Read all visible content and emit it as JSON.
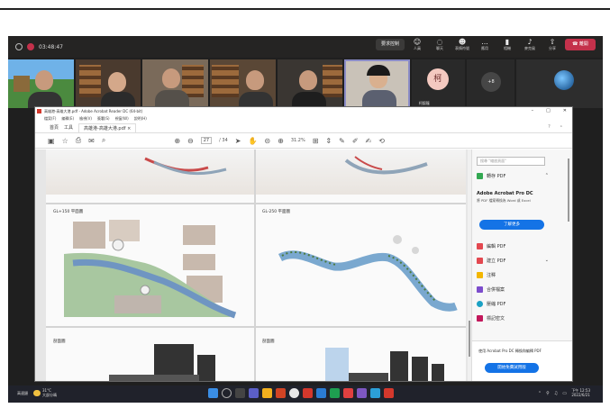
{
  "meeting": {
    "timer": "03:48:47",
    "actions": {
      "share_label": "要求控制",
      "people": "人員",
      "chat": "聊天",
      "reactions": "表情符號",
      "apps": "應用",
      "more": "...",
      "camera": "相機",
      "mic": "麥克風",
      "share": "分享",
      "leave_label": "離開"
    },
    "participants": {
      "avatar_initial": "柯",
      "avatar_name": "柯錦龍",
      "more_count": "+8"
    }
  },
  "reader": {
    "title": "高雄港-高雄大港.pdf - Adobe Acrobat Reader DC (64-bit)",
    "menu": [
      "檔案(F)",
      "編輯(E)",
      "檢視(V)",
      "簽署(S)",
      "視窗(W)",
      "說明(H)"
    ],
    "tabs": {
      "home": "首頁",
      "tools": "工具",
      "document": "高雄港-高雄大港.pdf"
    },
    "window_controls": {
      "minimize": "–",
      "maximize": "□",
      "close": "✕"
    },
    "toolbar": {
      "page_current": "27",
      "page_total": "/ 34",
      "zoom": "31.2%"
    },
    "document": {
      "label_gl150": "GL+150 平面圖",
      "label_gl250": "GL-250 平面圖",
      "label_section_left": "剖面圖",
      "label_section_right": "剖面圖"
    },
    "sidebar": {
      "search_placeholder": "搜尋 \"縮放頁面\"",
      "export_pdf": "轉存 PDF",
      "promo_title": "Adobe Acrobat Pro DC",
      "promo_text": "將 PDF 檔案轉換為 Word 或 Excel",
      "learn_more": "了解更多",
      "edit_pdf": "編輯 PDF",
      "create_pdf": "建立 PDF",
      "comment": "注釋",
      "combine": "合併檔案",
      "organize": "壓縮 PDF",
      "sign": "標記密文",
      "bottom_text": "使用 Acrobat Pro DC 轉換和編輯 PDF",
      "trial_button": "開始免費試用版"
    }
  },
  "taskbar": {
    "left_label": "高速鏈",
    "weather_temp": "31°C",
    "weather_desc": "大部分晴",
    "clock_time": "下午 12:53",
    "clock_date": "2022/6/21"
  }
}
